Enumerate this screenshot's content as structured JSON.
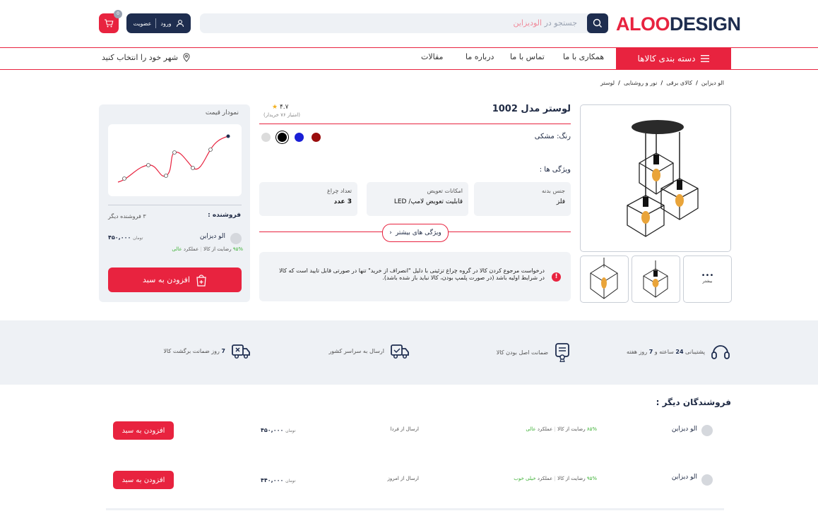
{
  "header": {
    "logo_part1": "ALOO",
    "logo_part2": "DESIGN",
    "search_placeholder_prefix": "جستجو در ",
    "search_placeholder_brand": "الودیزاین",
    "login_label": "ورود",
    "signup_label": "عضویت",
    "cart_count": "0"
  },
  "nav": {
    "categories_label": "دسته بندی کالاها",
    "items": [
      "همکاری با ما",
      "تماس با ما",
      "درباره ما",
      "مقالات"
    ],
    "city_label": "شهر خود را انتخاب کنید"
  },
  "breadcrumb": [
    "الو دیزاین",
    "کالای برقی",
    "نور و روشنایی",
    "لوستر"
  ],
  "product": {
    "title": "لوستر مدل 1002",
    "rating": "۴.۷",
    "rating_count": "(امتیاز ۷۶ خریدار)",
    "color_label": "رنگ: مشکی",
    "swatches": [
      "#9a0d0d",
      "#1a1fd6",
      "#000000",
      "#dcdcdc"
    ],
    "features_label": "ویژگی ها :",
    "features": [
      {
        "key": "جنس بدنه",
        "value": "فلز"
      },
      {
        "key": "امکانات تعویض",
        "value": "قابلیت تعویض لامپ/ LED"
      },
      {
        "key": "تعداد چراغ",
        "value": "3 عدد"
      }
    ],
    "more_features_label": "ویژگی های بیشتر",
    "notice": "درخواست مرجوع کردن کالا در گروه چراغ تزئینی با دلیل \"انصراف از خرید\" تنها در صورتی قابل تایید است که کالا در شرایط اولیه باشد (در صورت پلمپ بودن، کالا نباید باز شده باشد).",
    "more_images_label": "بیشتر"
  },
  "price_panel": {
    "chart_title": "نمودار قیمت",
    "seller_label": "فروشنده :",
    "other_sellers": "۳ فروشنده دیگر",
    "seller_name": "الو دیزاین",
    "price": "۴۵۰,۰۰۰",
    "currency": "تومان",
    "satisfaction_pct": "۹۵%",
    "satisfaction_label": "رضایت از کالا",
    "performance_label": "عملکرد",
    "performance_value": "عالی",
    "add_to_cart": "افزودن به سبد"
  },
  "services": [
    {
      "bold1": "24",
      "text": "پشتیبانی 24 ساعته و 7 روز هفته",
      "pre": "پشتیبانی ",
      "mid": " ساعته و ",
      "bold2": "7",
      "post": " روز هفته"
    },
    {
      "text": "ضمانت اصل بودن کالا"
    },
    {
      "text": "ارسال به سراسر کشور"
    },
    {
      "bold": "7",
      "text": " روز ضمانت برگشت کالا"
    }
  ],
  "other_sellers_section": {
    "title": "فروشندگان دیگر :",
    "rows": [
      {
        "name": "الو دیزاین",
        "satisfaction_pct": "۸۵%",
        "satisfaction_label": "رضایت از کالا",
        "performance_label": "عملکرد",
        "performance_value": "عالی",
        "shipping": "ارسال از فردا",
        "price": "۴۵۰,۰۰۰",
        "currency": "تومان",
        "button": "افزودن به سبد"
      },
      {
        "name": "الو دیزاین",
        "satisfaction_pct": "۹۵%",
        "satisfaction_label": "رضایت از کالا",
        "performance_label": "عملکرد",
        "performance_value": "خیلی خوب",
        "shipping": "ارسال از امروز",
        "price": "۴۴۰,۰۰۰",
        "currency": "تومان",
        "button": "افزودن به سبد"
      }
    ]
  },
  "colors": {
    "accent": "#e8233f",
    "navy": "#1e2d4f",
    "panel": "#eef1f5"
  }
}
